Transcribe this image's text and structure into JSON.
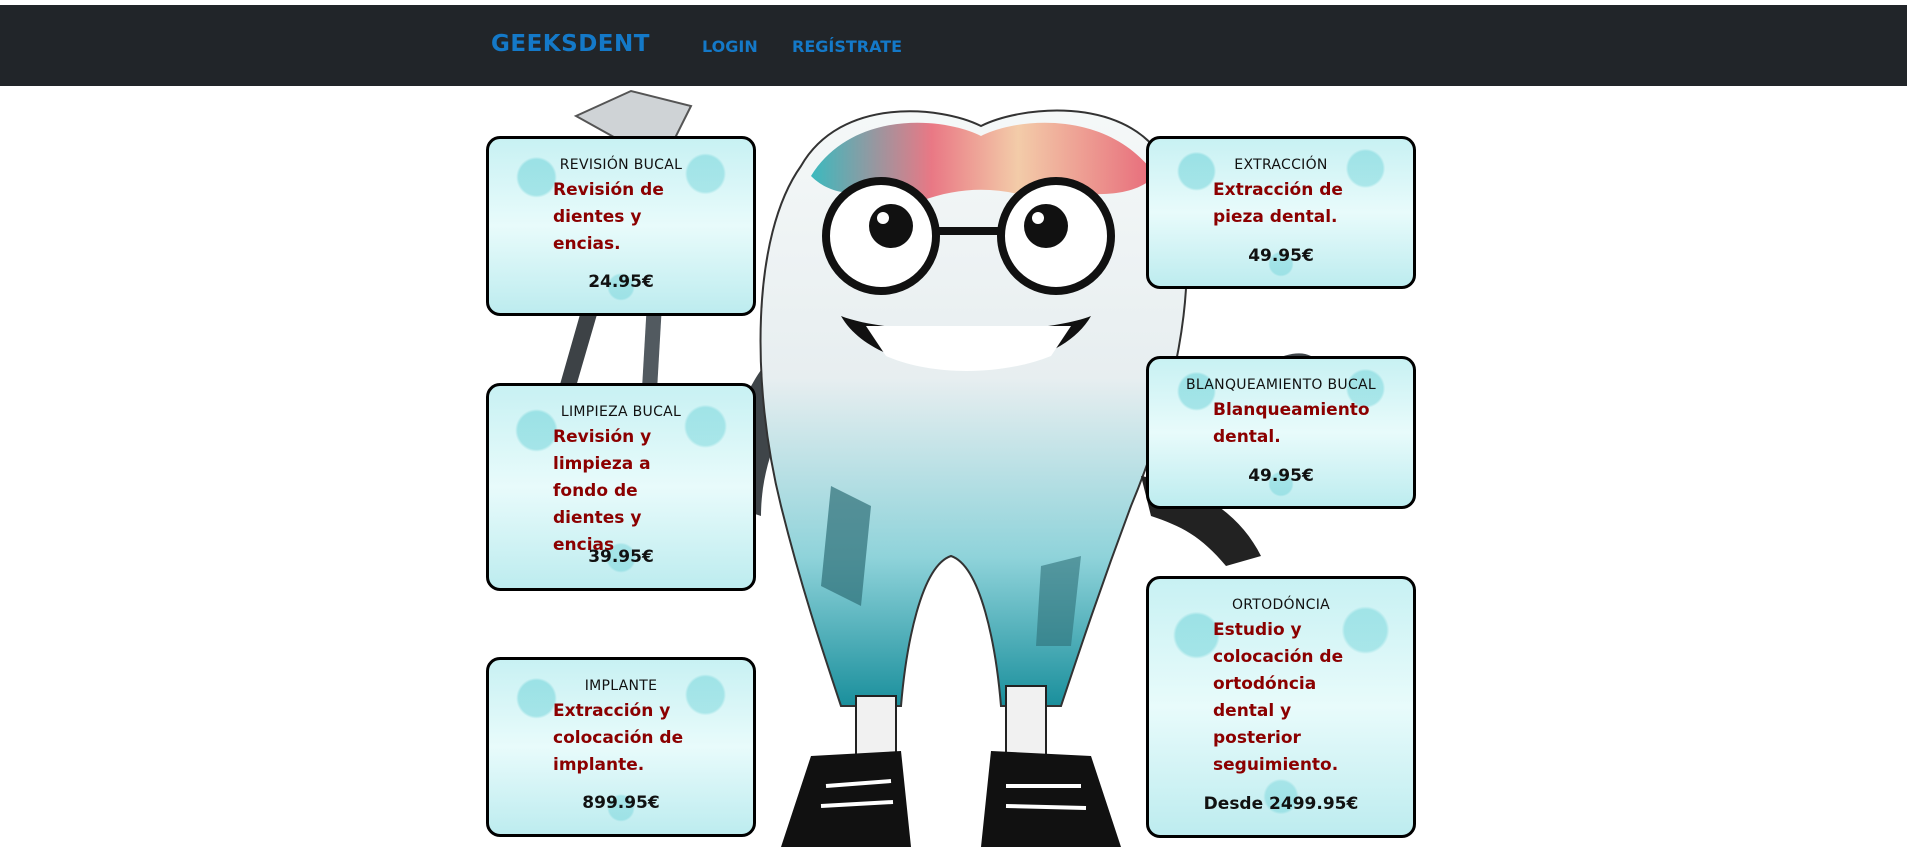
{
  "navbar": {
    "brand": "GEEKSDENT",
    "links": [
      {
        "label": "LOGIN"
      },
      {
        "label": "REGÍSTRATE"
      }
    ]
  },
  "colors": {
    "navbar_bg": "#212529",
    "link": "#1479c8",
    "desc": "#8b0000",
    "card_bg": "#c8f1f3"
  },
  "services": [
    {
      "title": "REVISIÓN BUCAL",
      "description": "Revisión de dientes y encias.",
      "price": "24.95€"
    },
    {
      "title": "EXTRACCIÓN",
      "description": "Extracción de pieza dental.",
      "price": "49.95€"
    },
    {
      "title": "LIMPIEZA BUCAL",
      "description": "Revisión y limpieza a fondo de dientes y encias",
      "price": "39.95€"
    },
    {
      "title": "BLANQUEAMIENTO BUCAL",
      "description": "Blanqueamiento dental.",
      "price": "49.95€"
    },
    {
      "title": "IMPLANTE",
      "description": "Extracción y colocación de implante.",
      "price": "899.95€"
    },
    {
      "title": "ORTODÓNCIA",
      "description": "Estudio y colocación de ortodóncia dental y posterior seguimiento.",
      "price": "Desde 2499.95€"
    }
  ],
  "background_image": {
    "icon": "tooth-mascot-illustration"
  }
}
